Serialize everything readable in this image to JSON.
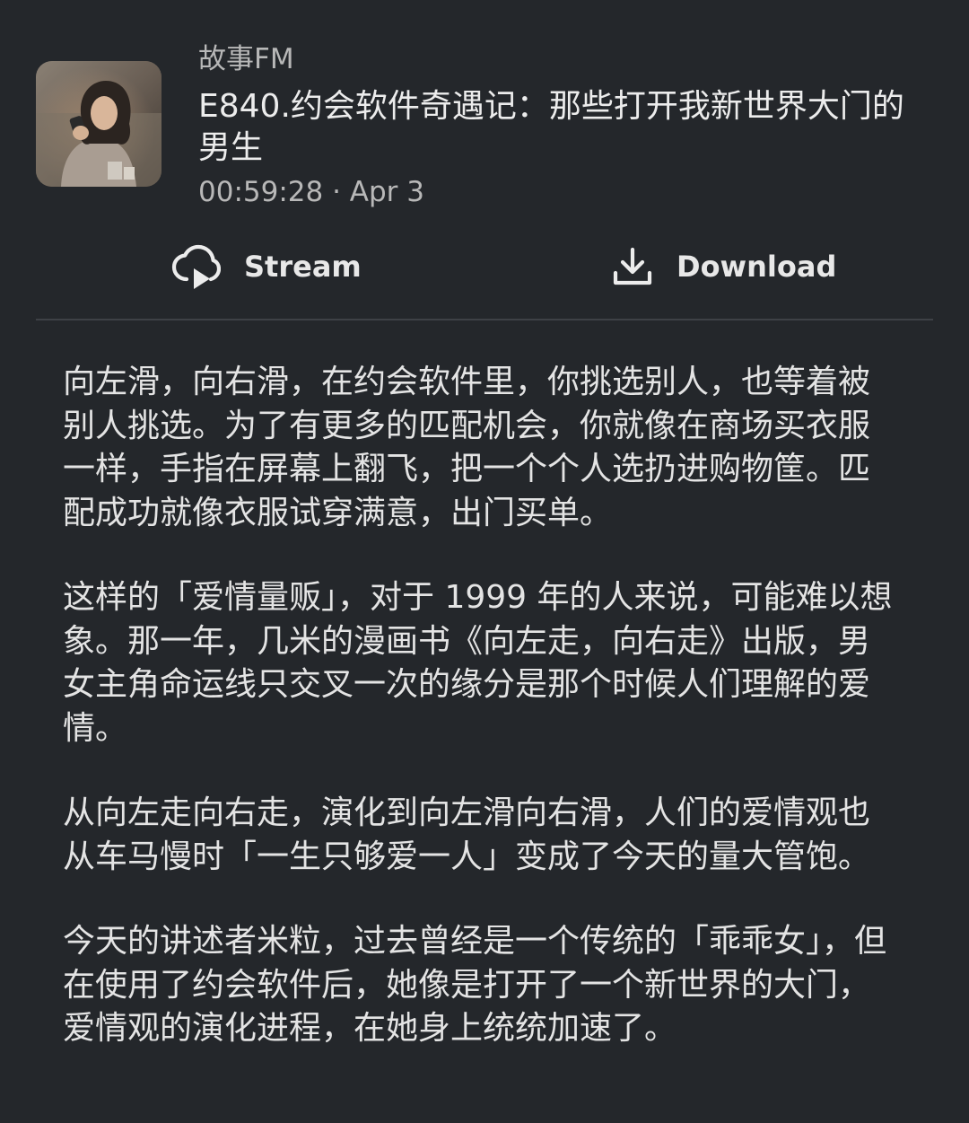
{
  "podcast": {
    "name": "故事FM",
    "cover_icon": "podcast-cover-image"
  },
  "episode": {
    "title": "E840.约会软件奇遇记：那些打开我新世界大门的男生",
    "duration": "00:59:28",
    "separator": " · ",
    "date": "Apr 3"
  },
  "actions": {
    "stream_label": "Stream",
    "stream_icon": "cloud-play-icon",
    "download_label": "Download",
    "download_icon": "download-icon"
  },
  "description": {
    "paragraphs": [
      "向左滑，向右滑，在约会软件里，你挑选别人，也等着被别人挑选。为了有更多的匹配机会，你就像在商场买衣服一样，手指在屏幕上翻飞，把一个个人选扔进购物筐。匹配成功就像衣服试穿满意，出门买单。",
      "这样的「爱情量贩」，对于 1999 年的人来说，可能难以想象。那一年，几米的漫画书《向左走，向右走》出版，男女主角命运线只交叉一次的缘分是那个时候人们理解的爱情。",
      "从向左走向右走，演化到向左滑向右滑，人们的爱情观也从车马慢时「一生只够爱一人」变成了今天的量大管饱。",
      "今天的讲述者米粒，过去曾经是一个传统的「乖乖女」，但在使用了约会软件后，她像是打开了一个新世界的大门，爱情观的演化进程，在她身上统统加速了。"
    ]
  },
  "colors": {
    "background": "#24272b",
    "text_primary": "#e4e4e4",
    "text_secondary": "#b8b8b8",
    "divider": "#3e4146"
  }
}
